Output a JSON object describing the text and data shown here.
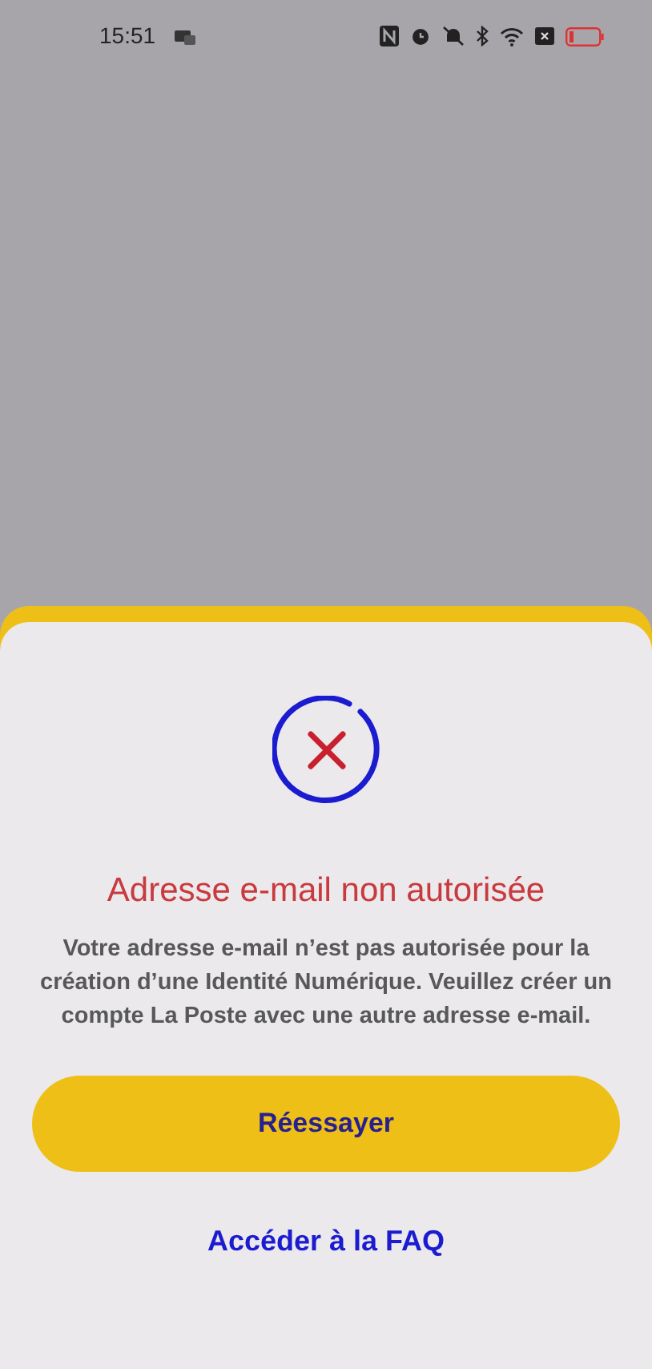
{
  "status_bar": {
    "time": "15:51"
  },
  "sheet": {
    "title": "Adresse e-mail non autorisée",
    "message": "Votre adresse e-mail n’est pas autorisée pour la création d’une Identité Numérique. Veuillez créer un compte La Poste avec une autre adresse e-mail.",
    "primary_button": "Réessayer",
    "link": "Accéder à la FAQ"
  }
}
